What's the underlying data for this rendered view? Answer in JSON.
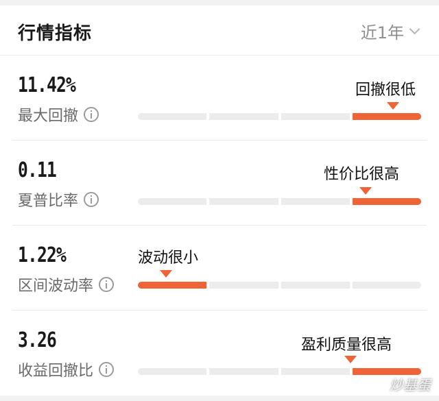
{
  "header": {
    "title": "行情指标",
    "range": "近1年"
  },
  "metrics": [
    {
      "value": "11.42%",
      "label": "最大回撤",
      "rating": "回撤很低",
      "active_segment": 4
    },
    {
      "value": "0.11",
      "label": "夏普比率",
      "rating": "性价比很高",
      "active_segment": 4
    },
    {
      "value": "1.22%",
      "label": "区间波动率",
      "rating": "波动很小",
      "active_segment": 1
    },
    {
      "value": "3.26",
      "label": "收益回撤比",
      "rating": "盈利质量很高",
      "active_segment": 4
    }
  ],
  "watermark": "炒基蛋",
  "colors": {
    "accent": "#ee6437",
    "track": "#ececec"
  }
}
